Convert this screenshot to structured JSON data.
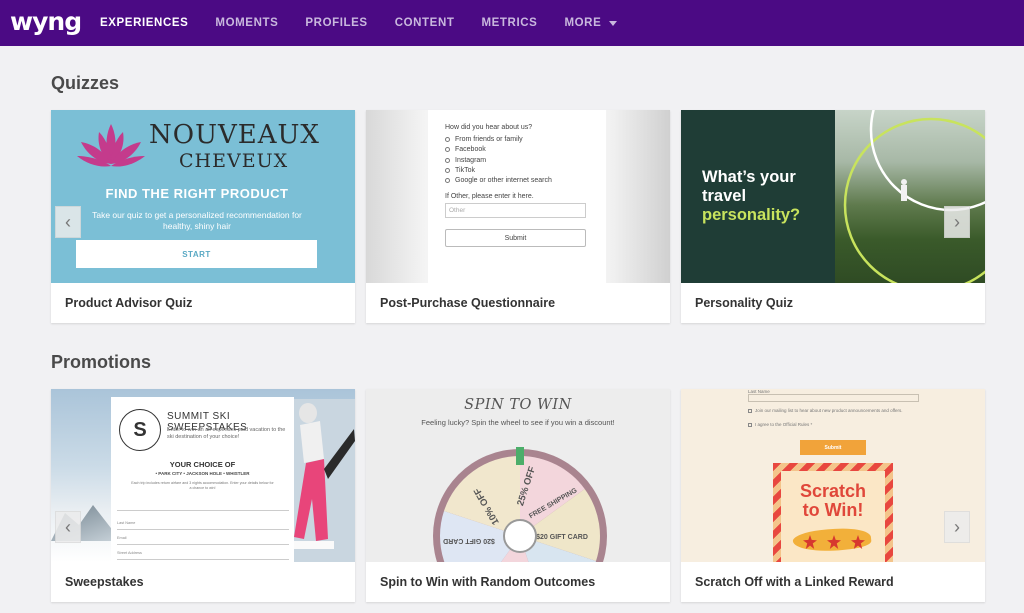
{
  "nav": {
    "logo": "wyng",
    "items": [
      {
        "label": "EXPERIENCES",
        "active": true
      },
      {
        "label": "MOMENTS",
        "active": false
      },
      {
        "label": "PROFILES",
        "active": false
      },
      {
        "label": "CONTENT",
        "active": false
      },
      {
        "label": "METRICS",
        "active": false
      },
      {
        "label": "MORE",
        "active": false,
        "dropdown": true
      }
    ]
  },
  "sections": {
    "quizzes": {
      "title": "Quizzes",
      "cards": [
        {
          "caption": "Product Advisor Quiz",
          "brand_line1": "NOUVEAUX",
          "brand_line2": "CHEVEUX",
          "heading": "FIND THE RIGHT PRODUCT",
          "subtext": "Take our quiz to get a personalized recommendation for healthy, shiny hair",
          "button": "START"
        },
        {
          "caption": "Post-Purchase Questionnaire",
          "question": "How did you hear about us?",
          "options": [
            "From friends or family",
            "Facebook",
            "Instagram",
            "TikTok",
            "Google or other internet search"
          ],
          "other_question": "If Other, please enter it here.",
          "other_placeholder": "Other",
          "submit": "Submit"
        },
        {
          "caption": "Personality Quiz",
          "line1": "What’s your",
          "line2": "travel",
          "line3": "personality?"
        }
      ]
    },
    "promotions": {
      "title": "Promotions",
      "cards": [
        {
          "caption": "Sweepstakes",
          "badge": "S",
          "title": "SUMMIT SKI SWEEPSTAKES",
          "desc": "Enter to win an all-expenses paid vacation to the ski destination of your choice!",
          "choice": "YOUR CHOICE OF",
          "cities": "• PARK CITY  • JACKSON HOLE  • WHISTLER",
          "fine": "Each trip includes return airfare and 3 nights accommodation. Enter your details below for a chance to win!",
          "fields": [
            "Last Name",
            "Email",
            "Street Address"
          ]
        },
        {
          "caption": "Spin to Win with Random Outcomes",
          "title": "SPIN TO WIN",
          "subtitle": "Feeling lucky? Spin the wheel to see if you win a discount!",
          "slices": [
            "25% OFF",
            "FREE SHIPPING",
            "$20 GIFT CARD",
            "$20 GIFT CARD",
            "10% OFF"
          ]
        },
        {
          "caption": "Scratch Off with a Linked Reward",
          "field_label": "Last Name",
          "checkbox1": "Join our mailing list to hear about new product announcements and offers.",
          "checkbox2": "I agree to the Official Rules *",
          "submit": "Submit",
          "scratch_line1": "Scratch",
          "scratch_line2": "to Win!"
        }
      ]
    }
  },
  "colors": {
    "nav_bg": "#4b0a84",
    "page_bg": "#f1f1f3",
    "accent_green": "#c8e35d"
  }
}
